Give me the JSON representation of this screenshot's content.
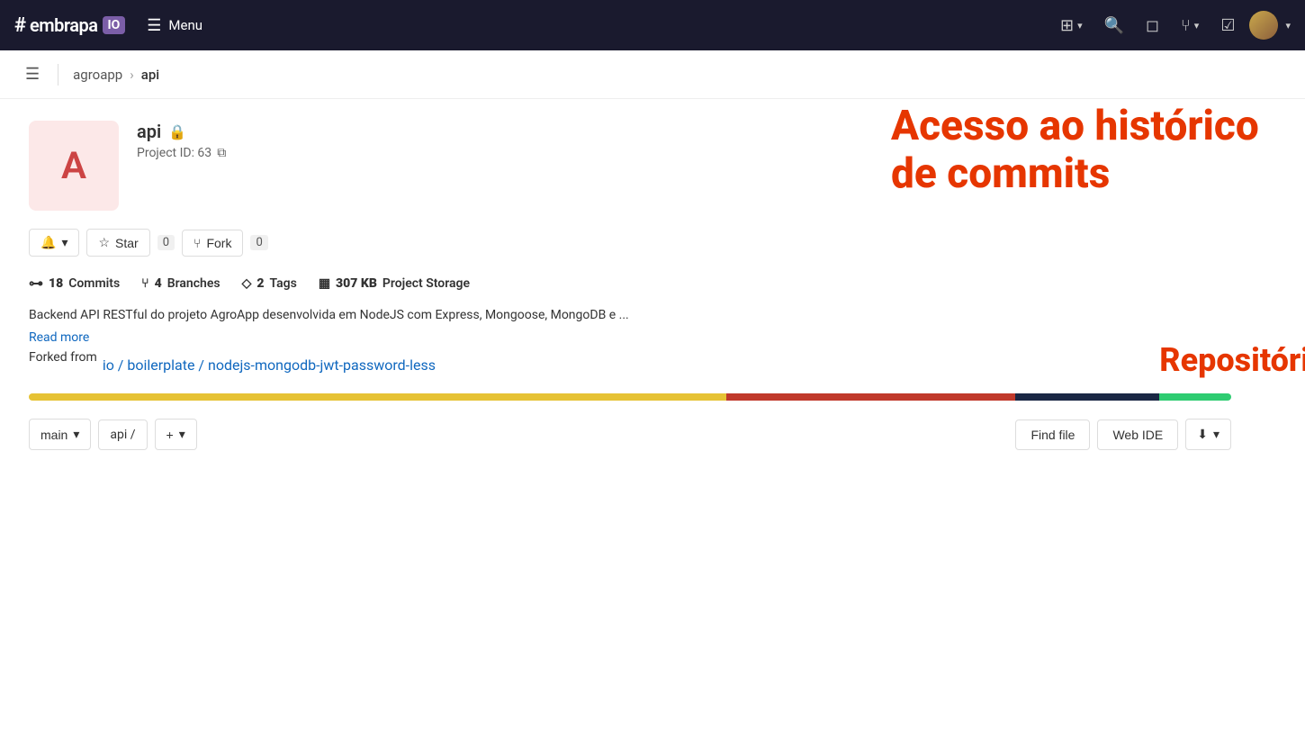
{
  "navbar": {
    "logo_hash": "#",
    "logo_text": "embrapa",
    "logo_io": "IO",
    "menu_label": "Menu",
    "actions": {
      "create_label": "+",
      "search_label": "🔍",
      "theme_label": "◻",
      "merge_label": "⑂",
      "todo_label": "☑",
      "avatar_label": "Avatar"
    }
  },
  "sub_header": {
    "breadcrumb": [
      {
        "label": "agroapp",
        "link": true
      },
      {
        "label": "api",
        "link": false
      }
    ]
  },
  "project": {
    "avatar_letter": "A",
    "name": "api",
    "project_id_label": "Project ID: 63",
    "description": "Backend API RESTful do projeto AgroApp desenvolvida em NodeJS com Express, Mongoose, MongoDB e ...",
    "read_more": "Read more",
    "forked_from_text": "Forked from",
    "fork_link_text": "io / boilerplate / nodejs-mongodb-jwt-password-less"
  },
  "stats": {
    "commits_count": "18",
    "commits_label": "Commits",
    "branches_count": "4",
    "branches_label": "Branches",
    "tags_count": "2",
    "tags_label": "Tags",
    "storage_size": "307 KB",
    "storage_label": "Project Storage"
  },
  "action_buttons": {
    "notification_label": "🔔",
    "star_label": "Star",
    "star_count": "0",
    "fork_label": "Fork",
    "fork_count": "0"
  },
  "annotations": {
    "line1": "Acesso ao histórico",
    "line2": "de commits",
    "repo_base": "Repositório-base"
  },
  "language_bar": [
    {
      "color": "#e6c234",
      "width": 58
    },
    {
      "color": "#c0392b",
      "width": 24
    },
    {
      "color": "#1a2744",
      "width": 12
    },
    {
      "color": "#2ecc71",
      "width": 6
    }
  ],
  "toolbar": {
    "branch_label": "main",
    "path_label": "api /",
    "plus_label": "+",
    "find_file_label": "Find file",
    "web_ide_label": "Web IDE",
    "download_label": "⬇"
  }
}
